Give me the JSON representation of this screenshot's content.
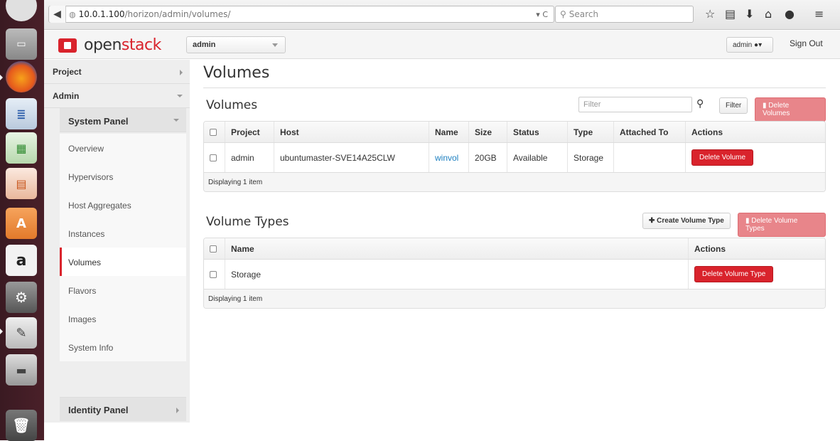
{
  "browser": {
    "url_host": "10.0.1.100",
    "url_path": "/horizon/admin/volumes/",
    "search_placeholder": "Search"
  },
  "topbar": {
    "logo_text_open": "open",
    "logo_text_stack": "stack",
    "project": "admin",
    "user": "admin",
    "signout": "Sign Out"
  },
  "sidebar": {
    "project": "Project",
    "admin": "Admin",
    "system_panel": "System Panel",
    "items": [
      "Overview",
      "Hypervisors",
      "Host Aggregates",
      "Instances",
      "Volumes",
      "Flavors",
      "Images",
      "System Info"
    ],
    "active_item": "Volumes",
    "identity_panel": "Identity Panel"
  },
  "main": {
    "page_title": "Volumes",
    "volumes_section": {
      "title": "Volumes",
      "filter_placeholder": "Filter",
      "filter_button": "Filter",
      "delete_button": "Delete Volumes",
      "columns": [
        "Project",
        "Host",
        "Name",
        "Size",
        "Status",
        "Type",
        "Attached To",
        "Actions"
      ],
      "rows": [
        {
          "project": "admin",
          "host": "ubuntumaster-SVE14A25CLW",
          "name": "winvol",
          "size": "20GB",
          "status": "Available",
          "type": "Storage",
          "attached_to": "",
          "action": "Delete Volume"
        }
      ],
      "footer": "Displaying 1 item"
    },
    "volume_types_section": {
      "title": "Volume Types",
      "create_button": "Create Volume Type",
      "delete_button": "Delete Volume Types",
      "columns": [
        "Name",
        "Actions"
      ],
      "rows": [
        {
          "name": "Storage",
          "action": "Delete Volume Type"
        }
      ],
      "footer": "Displaying 1 item"
    }
  },
  "colors": {
    "accent": "#d9232c",
    "link": "#1f80c1",
    "launcher": "#4a2029"
  }
}
